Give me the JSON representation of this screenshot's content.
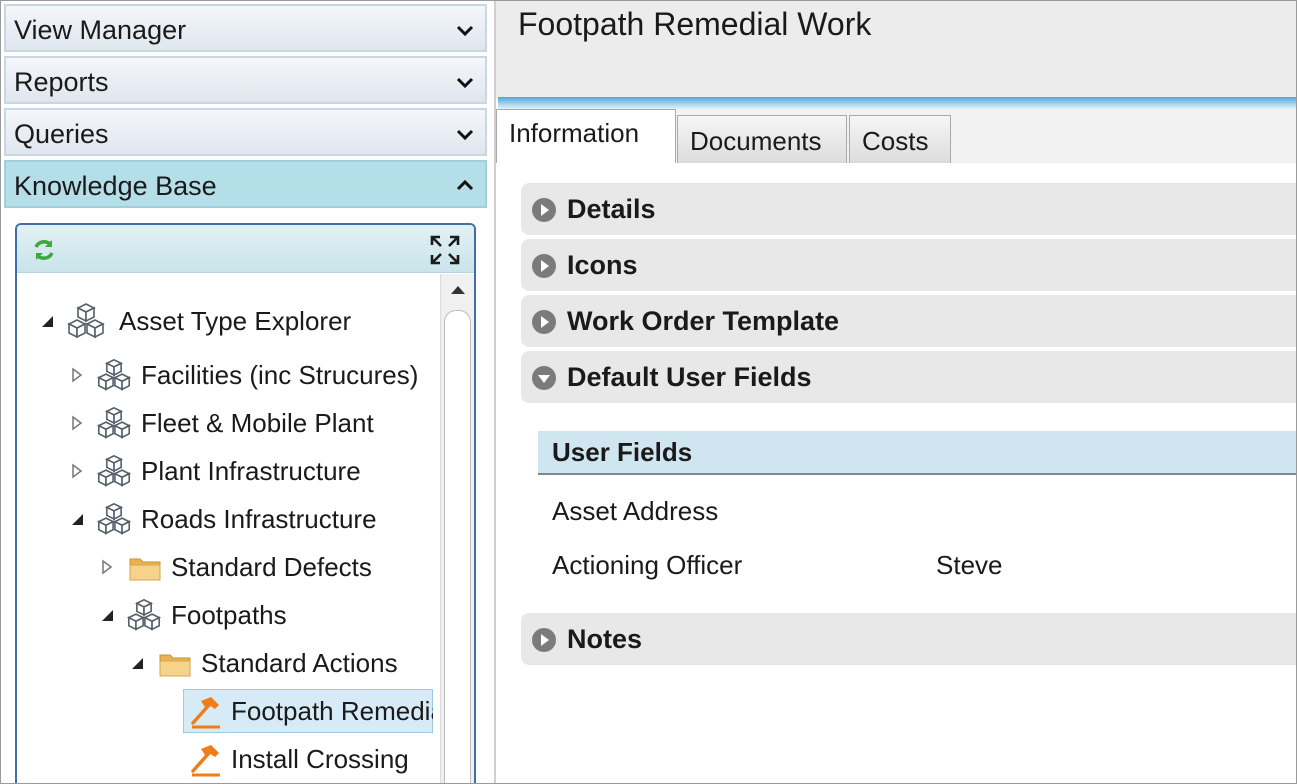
{
  "accordion": [
    {
      "label": "View Manager",
      "expanded": false
    },
    {
      "label": "Reports",
      "expanded": false
    },
    {
      "label": "Queries",
      "expanded": false
    },
    {
      "label": "Knowledge Base",
      "expanded": true
    }
  ],
  "tree": {
    "toolbar": {
      "refresh_icon": "refresh-icon",
      "expand_icon": "fullscreen-icon"
    },
    "nodes": [
      {
        "label": "Asset Type Explorer",
        "icon": "cubes-icon",
        "toggle": "expanded"
      },
      {
        "label": "Facilities (inc Strucures)",
        "icon": "cubes-icon",
        "toggle": "collapsed"
      },
      {
        "label": "Fleet & Mobile Plant",
        "icon": "cubes-icon",
        "toggle": "collapsed"
      },
      {
        "label": "Plant Infrastructure",
        "icon": "cubes-icon",
        "toggle": "collapsed"
      },
      {
        "label": "Roads Infrastructure",
        "icon": "cubes-icon",
        "toggle": "expanded"
      },
      {
        "label": "Standard Defects",
        "icon": "folder-icon",
        "toggle": "collapsed"
      },
      {
        "label": "Footpaths",
        "icon": "cubes-icon",
        "toggle": "expanded"
      },
      {
        "label": "Standard Actions",
        "icon": "folder-icon",
        "toggle": "expanded"
      },
      {
        "label": "Footpath Remedial Work",
        "icon": "hammer-icon",
        "toggle": "none",
        "selected": true
      },
      {
        "label": "Install Crossing",
        "icon": "hammer-icon",
        "toggle": "none"
      }
    ]
  },
  "detail": {
    "title": "Footpath Remedial Work",
    "tabs": [
      {
        "label": "Information",
        "active": true
      },
      {
        "label": "Documents",
        "active": false
      },
      {
        "label": "Costs",
        "active": false
      }
    ],
    "sections": [
      {
        "title": "Details",
        "expanded": false
      },
      {
        "title": "Icons",
        "expanded": false
      },
      {
        "title": "Work Order Template",
        "expanded": false
      },
      {
        "title": "Default User Fields",
        "expanded": true
      },
      {
        "title": "Notes",
        "expanded": false
      }
    ],
    "user_fields": {
      "header": "User Fields",
      "rows": [
        {
          "label": "Asset Address",
          "value": ""
        },
        {
          "label": "Actioning Officer",
          "value": "Steve"
        }
      ]
    }
  },
  "colors": {
    "accordion_active": "#b4dfe8",
    "tree_border": "#3f6fa5",
    "selection": "#d6ebf5",
    "hammer": "#f07d1a",
    "folder": "#f2c26b"
  }
}
